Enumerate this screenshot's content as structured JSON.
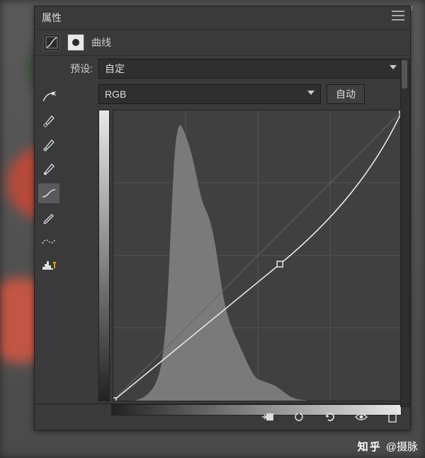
{
  "panel": {
    "title": "属性"
  },
  "type_row": {
    "label": "曲线"
  },
  "preset": {
    "label": "预设:",
    "value": "自定"
  },
  "channel": {
    "value": "RGB"
  },
  "auto_button": {
    "label": "自动"
  },
  "tools": [
    {
      "name": "target-adjust-icon"
    },
    {
      "name": "eyedropper-black-icon"
    },
    {
      "name": "eyedropper-gray-icon"
    },
    {
      "name": "eyedropper-white-icon"
    },
    {
      "name": "curve-smooth-icon"
    },
    {
      "name": "pencil-icon"
    },
    {
      "name": "smooth-icon"
    },
    {
      "name": "histogram-icon"
    }
  ],
  "chart_data": {
    "type": "line",
    "title": "",
    "xlabel": "",
    "ylabel": "",
    "xlim": [
      0,
      255
    ],
    "ylim": [
      0,
      255
    ],
    "grid": true,
    "curve_points": [
      {
        "x": 0,
        "y": 0
      },
      {
        "x": 147,
        "y": 120
      },
      {
        "x": 255,
        "y": 255
      }
    ],
    "histogram": [
      0,
      0,
      0,
      0,
      0,
      0,
      0,
      0,
      1,
      2,
      3,
      4,
      6,
      8,
      10,
      13,
      16,
      20,
      25,
      32,
      40,
      52,
      70,
      95,
      130,
      180,
      240,
      300,
      350,
      380,
      395,
      400,
      398,
      392,
      385,
      378,
      370,
      360,
      350,
      338,
      325,
      312,
      300,
      290,
      282,
      276,
      270,
      262,
      252,
      240,
      225,
      208,
      190,
      172,
      156,
      142,
      130,
      120,
      112,
      105,
      98,
      92,
      86,
      80,
      74,
      68,
      62,
      56,
      50,
      45,
      40,
      36,
      33,
      31,
      30,
      29,
      28,
      27,
      26,
      25,
      24,
      23,
      22,
      20,
      18,
      16,
      14,
      12,
      10,
      8,
      6,
      5,
      4,
      3,
      2,
      2,
      1,
      1,
      1,
      0,
      0,
      0,
      0,
      0,
      0,
      0,
      0,
      0,
      0,
      0,
      0,
      0,
      0,
      0,
      0,
      0,
      0,
      0,
      0,
      0,
      0,
      0,
      0,
      0,
      0,
      0,
      0,
      0
    ]
  },
  "footer_icons": [
    {
      "name": "clip-to-layer-icon"
    },
    {
      "name": "previous-state-icon"
    },
    {
      "name": "reset-icon"
    },
    {
      "name": "visibility-icon"
    },
    {
      "name": "trash-icon"
    }
  ],
  "watermark": {
    "logo": "知乎",
    "text": "@摄脉"
  }
}
